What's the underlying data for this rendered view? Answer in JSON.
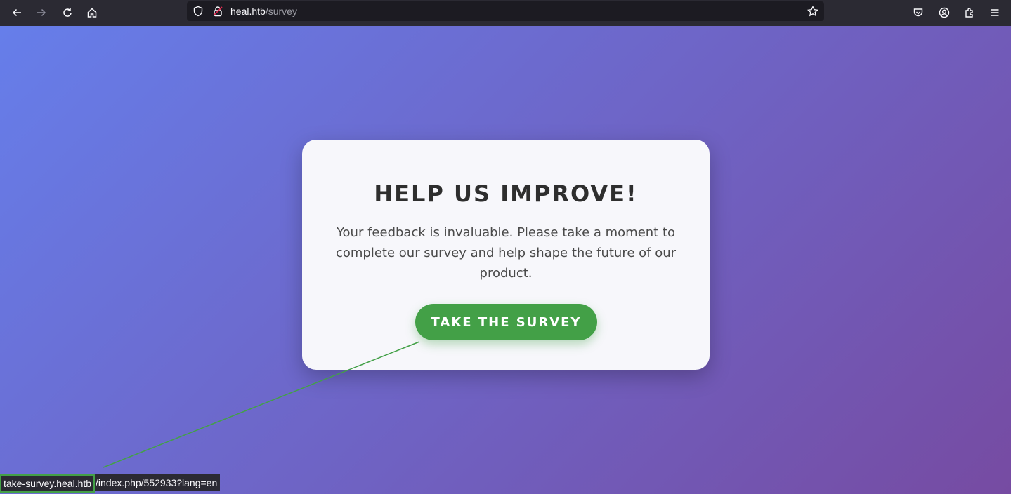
{
  "browser": {
    "url_host": "heal.htb",
    "url_path": "/survey",
    "icons": [
      "back-icon",
      "forward-icon",
      "reload-icon",
      "home-icon",
      "shield-icon",
      "lock-icon",
      "bookmark-star-icon",
      "pocket-icon",
      "account-icon",
      "extensions-icon",
      "menu-icon"
    ]
  },
  "card": {
    "title": "HELP US IMPROVE!",
    "text": "Your feedback is invaluable. Please take a moment to complete our survey and help shape the future of our product.",
    "button_label": "TAKE THE SURVEY"
  },
  "status": {
    "link_host": "take-survey.heal.htb",
    "link_rest": "/index.php/552933?lang=en"
  },
  "colors": {
    "gradient_start": "#667eea",
    "gradient_end": "#764ba2",
    "button": "#43a047",
    "card_bg": "#f7f7fb"
  }
}
